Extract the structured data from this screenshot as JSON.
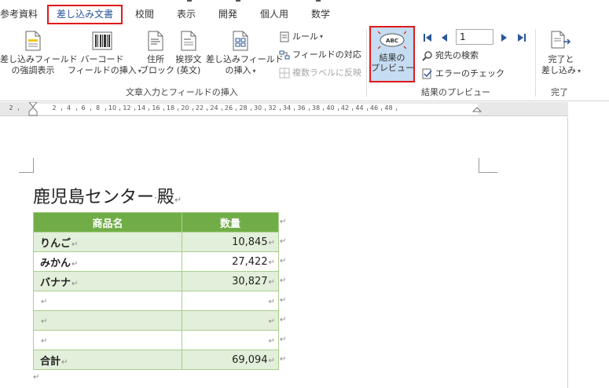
{
  "tabs": [
    {
      "label": "参考資料"
    },
    {
      "label": "差し込み文書",
      "active": true
    },
    {
      "label": "校閲"
    },
    {
      "label": "表示"
    },
    {
      "label": "開発"
    },
    {
      "label": "個人用"
    },
    {
      "label": "数学"
    }
  ],
  "ribbon": {
    "highlight_field": {
      "line1": "差し込みフィールド",
      "line2": "の強調表示"
    },
    "barcode_field": {
      "line1": "バーコード",
      "line2": "フィールドの挿入"
    },
    "address_block": {
      "line1": "住所",
      "line2": "ブロック"
    },
    "greeting_line": {
      "line1": "挨拶文",
      "line2": "(英文)"
    },
    "insert_merge_field": {
      "line1": "差し込みフィールド",
      "line2": "の挿入"
    },
    "rules": "ルール",
    "match_fields": "フィールドの対応",
    "update_labels": "複数ラベルに反映",
    "group_write_insert": "文章入力とフィールドの挿入",
    "preview_results": {
      "line1": "結果の",
      "line2": "プレビュー"
    },
    "record_number": "1",
    "find_recipient": "宛先の検索",
    "check_errors": "エラーのチェック",
    "group_preview": "結果のプレビュー",
    "finish_merge": {
      "line1": "完了と",
      "line2": "差し込み"
    },
    "group_finish": "完了"
  },
  "ruler": {
    "numbers": [
      "2",
      "2",
      "4",
      "6",
      "8",
      "10",
      "12",
      "14",
      "16",
      "18",
      "20",
      "22",
      "24",
      "26",
      "28",
      "30",
      "32",
      "34",
      "36",
      "38",
      "40",
      "42",
      "44",
      "46",
      "48"
    ]
  },
  "document": {
    "title": "鹿児島センター",
    "honorific": "殿",
    "table": {
      "headers": [
        "商品名",
        "数量"
      ],
      "rows": [
        {
          "name": "りんご",
          "qty": "10,845"
        },
        {
          "name": "みかん",
          "qty": "27,422"
        },
        {
          "name": "バナナ",
          "qty": "30,827"
        },
        {
          "name": "",
          "qty": ""
        },
        {
          "name": "",
          "qty": ""
        },
        {
          "name": "",
          "qty": ""
        },
        {
          "name": "合計",
          "qty": "69,094"
        }
      ]
    }
  },
  "colors": {
    "accent": "#2b579a",
    "table_header": "#70ad47",
    "table_band": "#e2efda",
    "highlight_border": "#e0191a",
    "preview_active": "#c5dcf2"
  }
}
